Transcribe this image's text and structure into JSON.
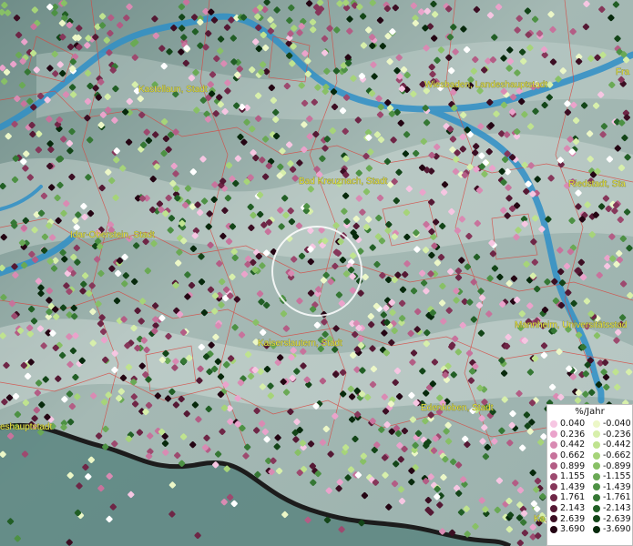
{
  "map": {
    "place_labels": [
      {
        "id": "kastellaun",
        "text": "Kastellaun, Stadt"
      },
      {
        "id": "wiesbaden",
        "text": "Wiesbaden, Landeshauptstadt"
      },
      {
        "id": "frankfurt",
        "text": "Fra"
      },
      {
        "id": "bad-kreuznach",
        "text": "Bad Kreuznach, Stadt"
      },
      {
        "id": "riedstadt",
        "text": "Riedstadt, Sta"
      },
      {
        "id": "idar-oberstein",
        "text": "Idar-Oberstein, Stadt"
      },
      {
        "id": "mannheim",
        "text": "Mannheim, Universitätsstad"
      },
      {
        "id": "kaiserslautern",
        "text": "Kaiserslautern, Stadt"
      },
      {
        "id": "edenkoben",
        "text": "Edenkoben, Stadt"
      },
      {
        "id": "mainz",
        "text": "eshauptstadt"
      },
      {
        "id": "karlsruhe",
        "text": "Ka"
      }
    ]
  },
  "legend": {
    "title": "%/Jahr",
    "rows": [
      {
        "pos": "0.040",
        "neg": "-0.040",
        "pos_color": "#f6c6e2",
        "neg_color": "#ecf7c7"
      },
      {
        "pos": "0.236",
        "neg": "-0.236",
        "pos_color": "#eaa3cb",
        "neg_color": "#d7efab"
      },
      {
        "pos": "0.442",
        "neg": "-0.442",
        "pos_color": "#d98bb3",
        "neg_color": "#bfe38f"
      },
      {
        "pos": "0.662",
        "neg": "-0.662",
        "pos_color": "#c7739c",
        "neg_color": "#a6d479"
      },
      {
        "pos": "0.899",
        "neg": "-0.899",
        "pos_color": "#b35d85",
        "neg_color": "#88c066"
      },
      {
        "pos": "1.155",
        "neg": "-1.155",
        "pos_color": "#9d4a6f",
        "neg_color": "#6aa955"
      },
      {
        "pos": "1.439",
        "neg": "-1.439",
        "pos_color": "#86375a",
        "neg_color": "#4d9144"
      },
      {
        "pos": "1.761",
        "neg": "-1.761",
        "pos_color": "#6e2646",
        "neg_color": "#357734"
      },
      {
        "pos": "2.143",
        "neg": "-2.143",
        "pos_color": "#551934",
        "neg_color": "#215e25"
      },
      {
        "pos": "2.639",
        "neg": "-2.639",
        "pos_color": "#3c0e23",
        "neg_color": "#134518"
      },
      {
        "pos": "3.690",
        "neg": "-3.690",
        "pos_color": "#240513",
        "neg_color": "#07290c"
      }
    ]
  }
}
